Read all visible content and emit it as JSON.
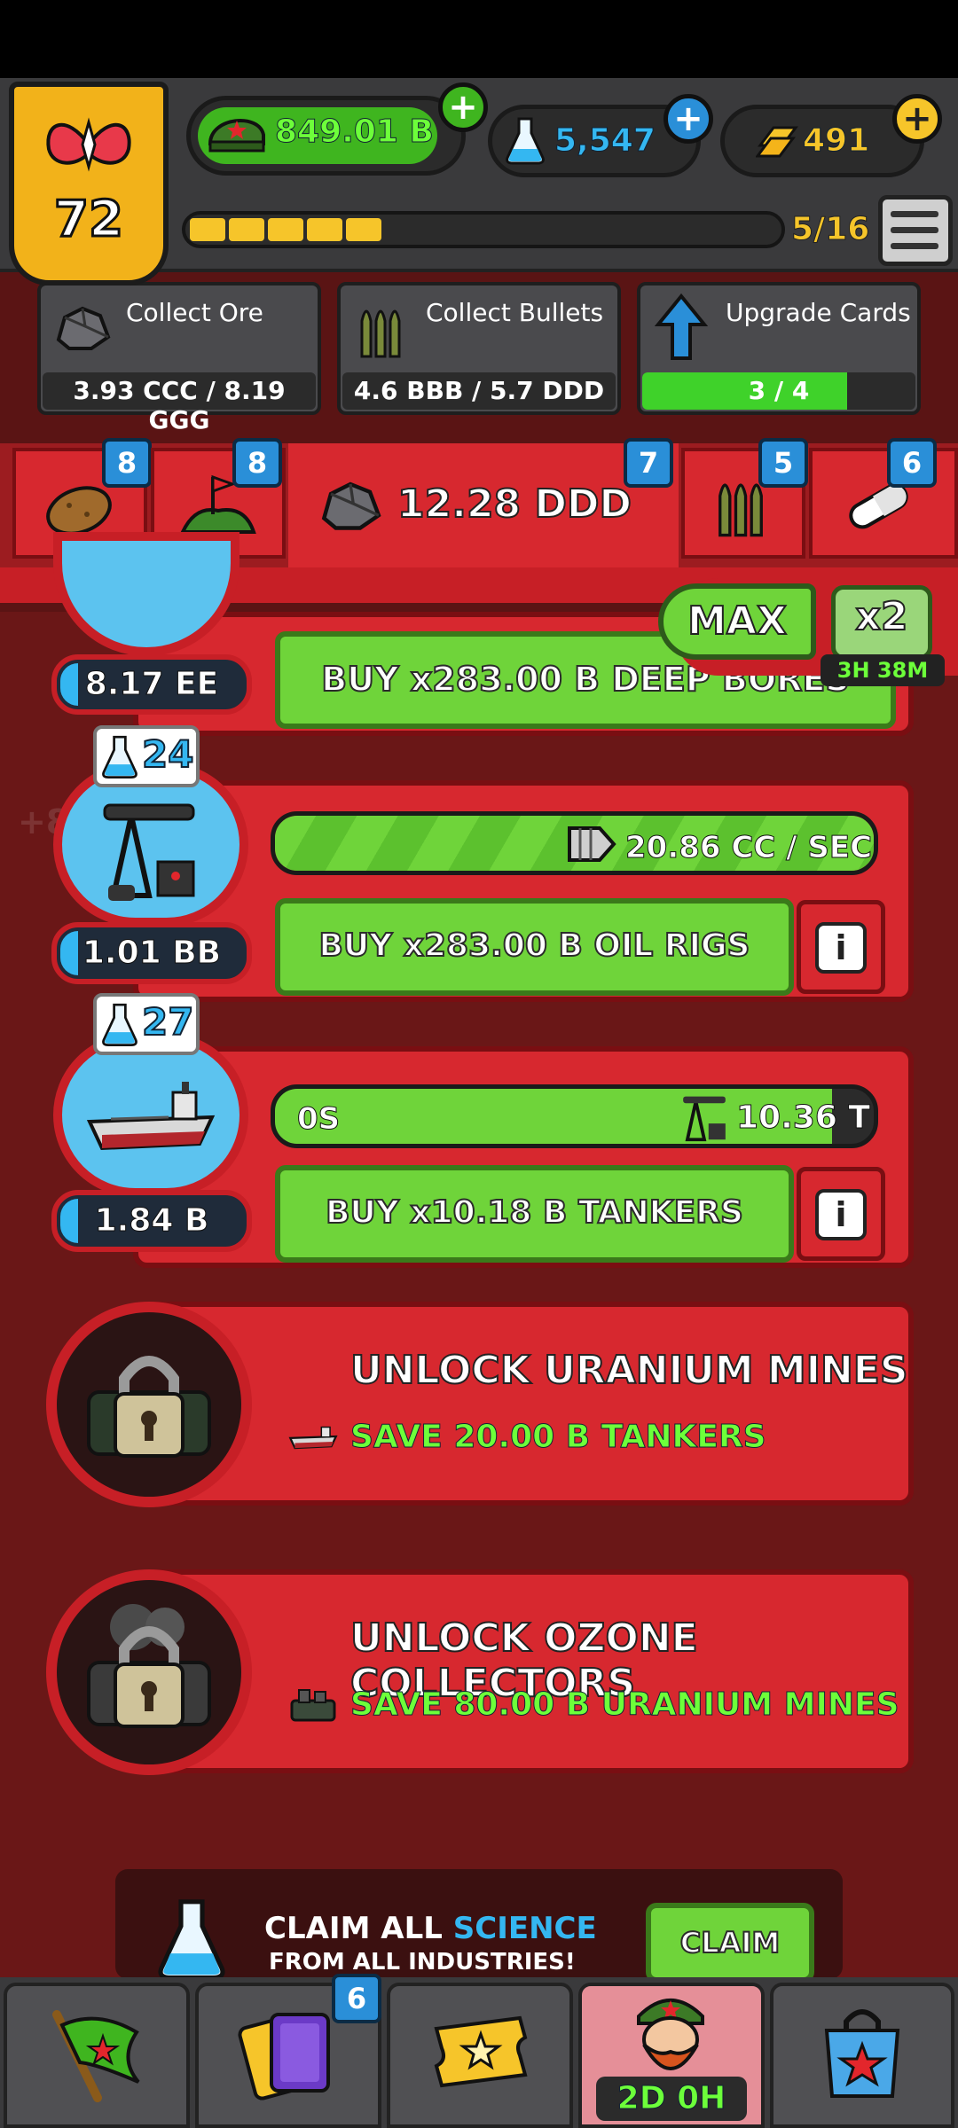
{
  "hud": {
    "level": "72",
    "cash": "849.01 B",
    "science": "5,547",
    "gold": "491",
    "progress_text": "5/16",
    "progress_fraction": 0.3125
  },
  "quests": [
    {
      "title": "Collect Ore",
      "sub": "3.93 CCC / 8.19 GGG"
    },
    {
      "title": "Collect Bullets",
      "sub": "4.6 BBB / 5.7 DDD"
    },
    {
      "title": "Upgrade Cards",
      "sub": "3 / 4",
      "progress_fraction": 0.75
    }
  ],
  "tabs": {
    "potato_count": "8",
    "flag_count": "8",
    "ore_total": "12.28 DDD",
    "ore_count": "7",
    "bullets_count": "5",
    "pill_count": "6"
  },
  "buy_mode": {
    "label": "MAX"
  },
  "boost": {
    "multiplier": "x2",
    "timer": "3H 38M"
  },
  "industries": [
    {
      "name": "Deep Bores",
      "owned": "8.17 EE",
      "buy_label": "BUY x283.00 B DEEP BORES"
    },
    {
      "name": "Oil Rigs",
      "science": "24",
      "owned": "1.01 BB",
      "rate": "20.86 CC / SEC",
      "buy_label": "BUY x283.00 B OIL RIGS",
      "ghost": "+84.74 AA"
    },
    {
      "name": "Tankers",
      "science": "27",
      "owned": "1.84 B",
      "timer": "0S",
      "output": "10.36 T",
      "buy_label": "BUY x10.18 B TANKERS"
    }
  ],
  "unlocks": [
    {
      "title": "UNLOCK URANIUM MINES",
      "save": "SAVE 20.00 B TANKERS"
    },
    {
      "title": "UNLOCK OZONE COLLECTORS",
      "save": "SAVE 80.00 B URANIUM MINES"
    }
  ],
  "claim": {
    "line1_a": "CLAIM ALL",
    "line1_b": "SCIENCE",
    "line2": "FROM ALL INDUSTRIES!",
    "button": "CLAIM"
  },
  "nav": {
    "cards_badge": "6",
    "event_timer": "2D 0H"
  },
  "colors": {
    "accent_green": "#6fd43a",
    "science_blue": "#34b7f1",
    "gold": "#f6c52a",
    "panel_red": "#d7282f"
  }
}
